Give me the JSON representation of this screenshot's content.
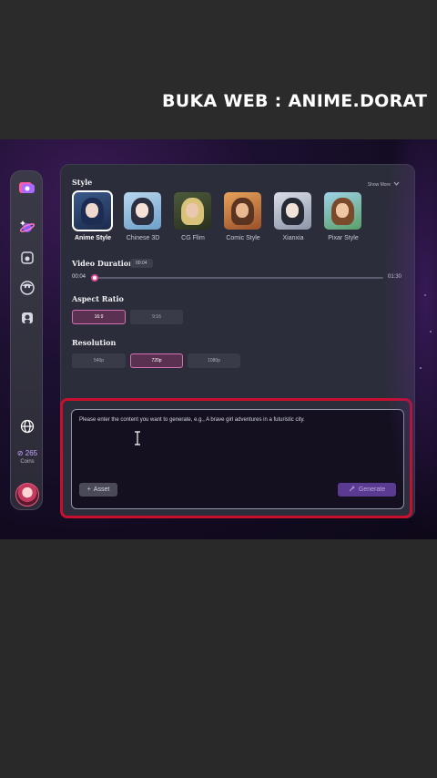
{
  "banner": {
    "text": "BUKA WEB : ANIME.DORAT"
  },
  "sidebar": {
    "icons": [
      "video-camera-icon",
      "sparkle-planet-icon",
      "photo-icon",
      "face-icon",
      "portrait-icon",
      "globe-icon"
    ],
    "coins_value": "265",
    "coins_label": "Coins"
  },
  "style_section": {
    "label": "Style",
    "show_more": "Show More",
    "items": [
      {
        "name": "Anime Style",
        "selected": true
      },
      {
        "name": "Chinese 3D",
        "selected": false
      },
      {
        "name": "CG Flim",
        "selected": false
      },
      {
        "name": "Comic Style",
        "selected": false
      },
      {
        "name": "Xianxia",
        "selected": false
      },
      {
        "name": "Pixar Style",
        "selected": false
      }
    ]
  },
  "duration": {
    "label": "Video Duration",
    "badge": "00:04",
    "start": "00:04",
    "end": "01:30",
    "progress": 0.0
  },
  "aspect": {
    "label": "Aspect Ratio",
    "options": [
      {
        "label": "16:9",
        "selected": true
      },
      {
        "label": "9:16",
        "selected": false
      }
    ]
  },
  "resolution": {
    "label": "Resolution",
    "options": [
      {
        "label": "540p",
        "selected": false
      },
      {
        "label": "720p",
        "selected": true
      },
      {
        "label": "1080p",
        "selected": false
      }
    ]
  },
  "prompt": {
    "placeholder": "Please enter the content you want to generate, e.g., A brave girl adventures in a futuristic city.",
    "asset_label": "Asset",
    "generate_label": "Generate"
  },
  "colors": {
    "accent": "#d273b0",
    "generate": "#5b3b92",
    "highlight": "#c8102e"
  }
}
